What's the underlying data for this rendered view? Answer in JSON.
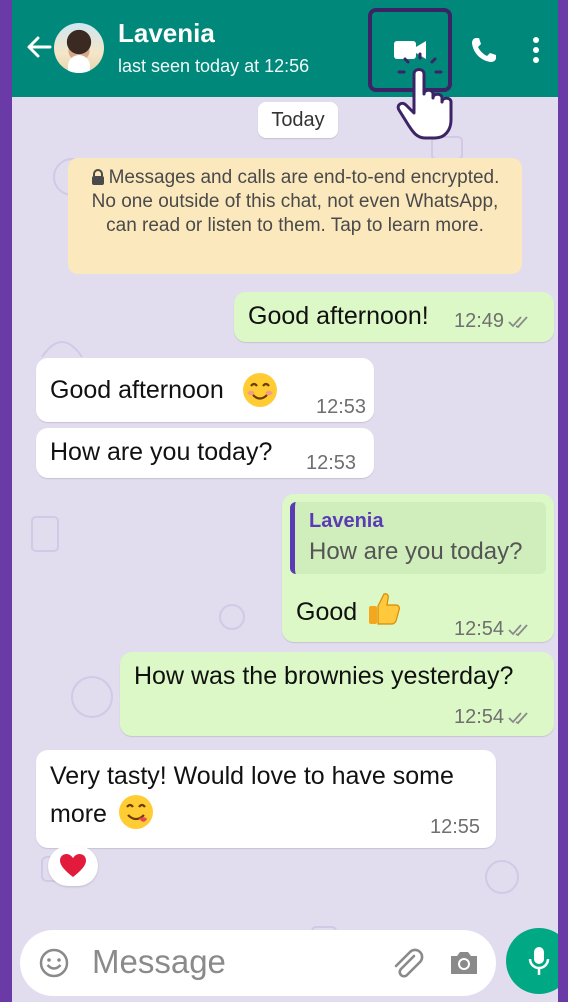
{
  "header": {
    "contact_name": "Lavenia",
    "last_seen": "last seen today at 12:56",
    "accent_color": "#00897b"
  },
  "chat": {
    "date_chip": "Today",
    "encryption_notice": "Messages and calls are end-to-end encrypted. No one outside of this chat, not even WhatsApp, can read or listen to them. Tap to learn more.",
    "messages": [
      {
        "direction": "out",
        "text": "Good afternoon!",
        "time": "12:49"
      },
      {
        "direction": "in",
        "text": "Good afternoon",
        "emoji": "smiling-face-icon",
        "time": "12:53"
      },
      {
        "direction": "in",
        "text": "How are you today?",
        "time": "12:53"
      },
      {
        "direction": "out",
        "reply_to_name": "Lavenia",
        "reply_to_text": "How are you today?",
        "text": "Good",
        "emoji": "thumbs-up-icon",
        "time": "12:54"
      },
      {
        "direction": "out",
        "text": "How was the brownies yesterday?",
        "time": "12:54"
      },
      {
        "direction": "in",
        "text_line1": "Very tasty! Would love to have some",
        "text_line2": "more",
        "emoji": "savoring-food-face-icon",
        "time": "12:55",
        "reaction": "heart-icon"
      }
    ]
  },
  "input": {
    "placeholder": "Message"
  }
}
